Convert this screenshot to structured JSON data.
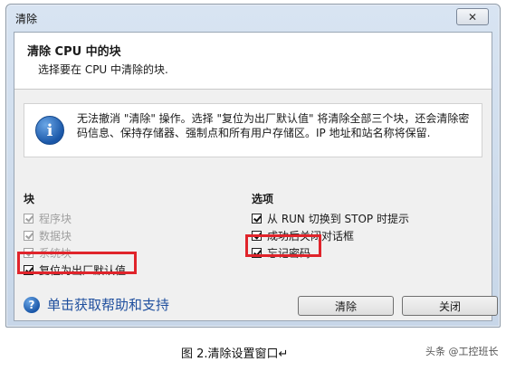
{
  "window": {
    "title": "清除",
    "close_glyph": "✕"
  },
  "header": {
    "title": "清除 CPU 中的块",
    "subtitle": "选择要在 CPU 中清除的块."
  },
  "info": {
    "icon": "info-icon",
    "text": "无法撤消 \"清除\" 操作。选择 \"复位为出厂默认值\" 将清除全部三个块，还会清除密码信息、保持存储器、强制点和所有用户存储区。IP 地址和站名称将保留."
  },
  "blocks": {
    "title": "块",
    "items": [
      {
        "label": "程序块",
        "checked": true,
        "enabled": false
      },
      {
        "label": "数据块",
        "checked": true,
        "enabled": false
      },
      {
        "label": "系统块",
        "checked": true,
        "enabled": false
      },
      {
        "label": "复位为出厂默认值",
        "checked": true,
        "enabled": true
      }
    ]
  },
  "options": {
    "title": "选项",
    "items": [
      {
        "label": "从 RUN 切换到 STOP 时提示",
        "checked": true,
        "enabled": true
      },
      {
        "label": "成功后关闭对话框",
        "checked": true,
        "enabled": true
      },
      {
        "label": "忘记密码",
        "checked": true,
        "enabled": true
      }
    ]
  },
  "help": {
    "label": "单击获取帮助和支持",
    "icon": "help-icon"
  },
  "buttons": {
    "clear": "清除",
    "close": "关闭"
  },
  "caption": "图 2.清除设置窗口↵",
  "watermark": "头条 @工控班长",
  "colors": {
    "highlight": "#e0242b",
    "link": "#1f4f9e"
  }
}
